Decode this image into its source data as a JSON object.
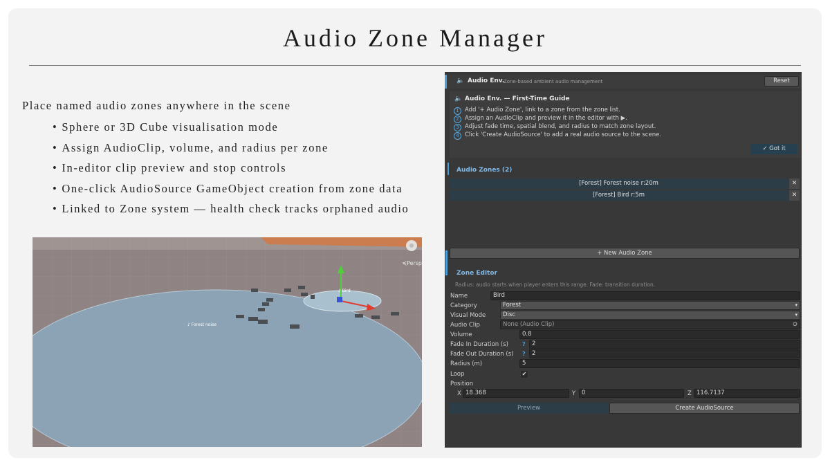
{
  "slide": {
    "title": "Audio Zone Manager",
    "lead": "Place named audio zones anywhere in the scene",
    "bullets": [
      "Sphere or 3D Cube visualisation mode",
      "Assign AudioClip, volume, and radius per zone",
      "In-editor clip preview and stop controls",
      "One-click AudioSource GameObject creation from zone data",
      "Linked to Zone system — health check tracks orphaned audio"
    ]
  },
  "scene": {
    "perspective_label": "≼Persp",
    "forest_label": "♪ Forest noise",
    "bird_label": "♪ Bird"
  },
  "inspector": {
    "header": {
      "icon": "speaker-icon",
      "title": "Audio Env.",
      "subtitle": "Zone-based ambient audio management",
      "reset_label": "Reset"
    },
    "guide": {
      "title": "Audio Env.  —  First-Time Guide",
      "steps": [
        {
          "num": "1",
          "text": "Add '+ Audio Zone', link to a zone from the zone list."
        },
        {
          "num": "2",
          "text": "Assign an AudioClip and preview it in the editor with ▶."
        },
        {
          "num": "3",
          "text": "Adjust fade time, spatial blend, and radius to match zone layout."
        },
        {
          "num": "4",
          "text": "Click 'Create AudioSource' to add a real audio source to the scene."
        }
      ],
      "got_it_label": "✓ Got it"
    },
    "zones": {
      "title": "Audio Zones (2)",
      "items": [
        {
          "label": "[Forest] Forest noise  r:20m"
        },
        {
          "label": "[Forest] Bird  r:5m"
        }
      ],
      "remove_glyph": "✕",
      "new_zone_label": "+ New Audio Zone"
    },
    "editor": {
      "title": "Zone Editor",
      "hint": "Radius: audio starts when player enters this range. Fade: transition duration.",
      "name_label": "Name",
      "name_value": "Bird",
      "category_label": "Category",
      "category_value": "Forest",
      "visual_mode_label": "Visual Mode",
      "visual_mode_value": "Disc",
      "audio_clip_label": "Audio Clip",
      "audio_clip_value": "None (Audio Clip)",
      "volume_label": "Volume",
      "volume_value": "0.8",
      "fade_in_label": "Fade In Duration (s)",
      "fade_in_value": "2",
      "fade_out_label": "Fade Out Duration (s)",
      "fade_out_value": "2",
      "radius_label": "Radius (m)",
      "radius_value": "5",
      "loop_label": "Loop",
      "loop_checked": true,
      "position_label": "Position",
      "x_label": "X",
      "x_value": "18.368",
      "y_label": "Y",
      "y_value": "0",
      "z_label": "Z",
      "z_value": "116.7137",
      "help_glyph": "?",
      "check_glyph": "✔",
      "dropdown_glyph": "▾",
      "target_glyph": "⊙",
      "preview_label": "Preview",
      "create_label": "Create AudioSource"
    }
  },
  "colors": {
    "accent": "#4a9fd6",
    "panel": "#383838",
    "zone_disc": "#8ba3b5",
    "ground": "#8f8483"
  }
}
